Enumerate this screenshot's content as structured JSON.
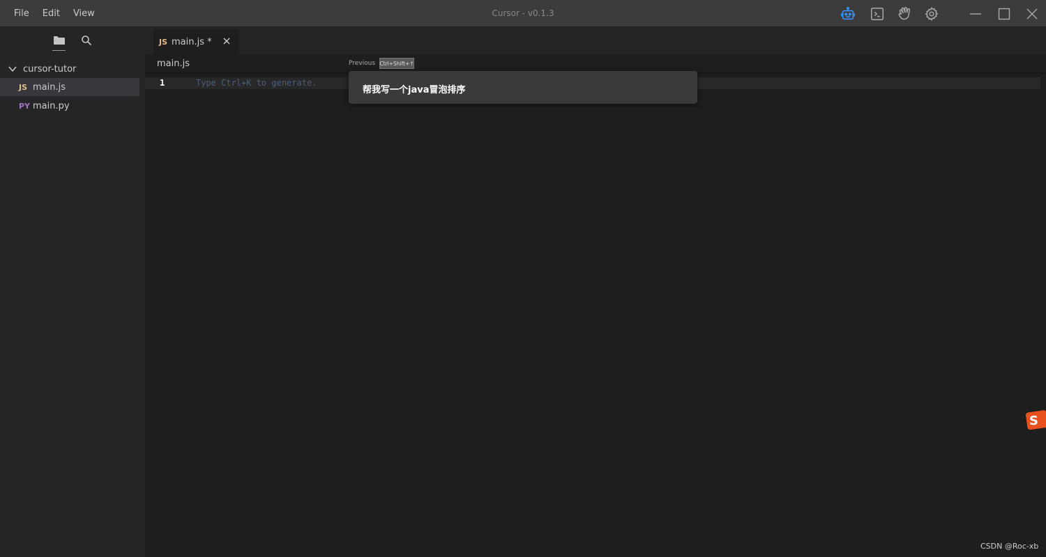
{
  "menu": {
    "file": "File",
    "edit": "Edit",
    "view": "View"
  },
  "window": {
    "title": "Cursor - v0.1.3"
  },
  "toolbar_icons": [
    "robot-icon",
    "terminal-icon",
    "hand-wave-icon",
    "gear-icon"
  ],
  "sidebar": {
    "folder": "cursor-tutor",
    "files": [
      {
        "badge": "JS",
        "name": "main.js",
        "badge_color": "#e2c08d",
        "active": true
      },
      {
        "badge": "PY",
        "name": "main.py",
        "badge_color": "#a074c4",
        "active": false
      }
    ]
  },
  "tab": {
    "badge": "JS",
    "label": "main.js *"
  },
  "editor": {
    "breadcrumb": "main.js",
    "line_number": "1",
    "placeholder": "Type Ctrl+K to generate."
  },
  "prompt": {
    "previous_label": "Previous",
    "shortcut": "Ctrl+Shift+↑",
    "text": "帮我写一个java冒泡排序"
  },
  "watermark": "CSDN @Roc-xb",
  "colors": {
    "accent_blue": "#3794ff",
    "titlebar": "#3c3c3c",
    "sidebar": "#252526",
    "editor": "#1e1e1e"
  }
}
